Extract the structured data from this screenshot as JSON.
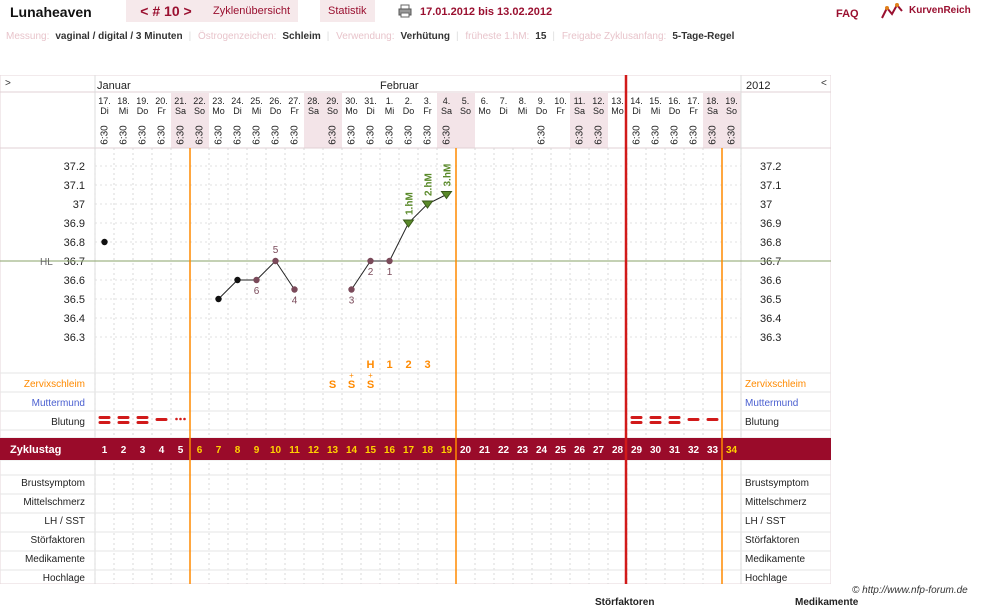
{
  "header": {
    "username": "Lunaheaven",
    "cycle_nav": "< # 10 >",
    "tabs": [
      "Zyklenübersicht",
      "Statistik"
    ],
    "date_range": "17.01.2012 bis 13.02.2012",
    "faq": "FAQ",
    "logo_text": "KurvenReich",
    "icons": [
      "printer-icon",
      "kurvenreich-logo-icon"
    ]
  },
  "settings": [
    {
      "label": "Messung:",
      "value": "vaginal / digital / 3 Minuten"
    },
    {
      "label": "Östrogenzeichen:",
      "value": "Schleim"
    },
    {
      "label": "Verwendung:",
      "value": "Verhütung"
    },
    {
      "label": "früheste 1.hM:",
      "value": "15"
    },
    {
      "label": "Freigabe Zyklusanfang:",
      "value": "5-Tage-Regel"
    }
  ],
  "chart": {
    "nav_left": ">",
    "nav_right": "<",
    "month_labels": [
      "Januar",
      "Februar"
    ],
    "year": "2012",
    "days": [
      {
        "date": "17.",
        "wd": "Di",
        "time": "6:30"
      },
      {
        "date": "18.",
        "wd": "Mi",
        "time": "6:30"
      },
      {
        "date": "19.",
        "wd": "Do",
        "time": "6:30"
      },
      {
        "date": "20.",
        "wd": "Fr",
        "time": "6:30"
      },
      {
        "date": "21.",
        "wd": "Sa",
        "time": "6:30"
      },
      {
        "date": "22.",
        "wd": "So",
        "time": "6:30"
      },
      {
        "date": "23.",
        "wd": "Mo",
        "time": "6:30"
      },
      {
        "date": "24.",
        "wd": "Di",
        "time": "6:30"
      },
      {
        "date": "25.",
        "wd": "Mi",
        "time": "6:30"
      },
      {
        "date": "26.",
        "wd": "Do",
        "time": "6:30"
      },
      {
        "date": "27.",
        "wd": "Fr",
        "time": "6:30"
      },
      {
        "date": "28.",
        "wd": "Sa",
        "time": ""
      },
      {
        "date": "29.",
        "wd": "So",
        "time": "6:30"
      },
      {
        "date": "30.",
        "wd": "Mo",
        "time": "6:30"
      },
      {
        "date": "31.",
        "wd": "Di",
        "time": "6:30"
      },
      {
        "date": "1.",
        "wd": "Mi",
        "time": "6:30"
      },
      {
        "date": "2.",
        "wd": "Do",
        "time": "6:30"
      },
      {
        "date": "3.",
        "wd": "Fr",
        "time": "6:30"
      },
      {
        "date": "4.",
        "wd": "Sa",
        "time": "6:30"
      },
      {
        "date": "5.",
        "wd": "So",
        "time": ""
      },
      {
        "date": "6.",
        "wd": "Mo",
        "time": ""
      },
      {
        "date": "7.",
        "wd": "Di",
        "time": ""
      },
      {
        "date": "8.",
        "wd": "Mi",
        "time": ""
      },
      {
        "date": "9.",
        "wd": "Do",
        "time": "6:30"
      },
      {
        "date": "10.",
        "wd": "Fr",
        "time": ""
      },
      {
        "date": "11.",
        "wd": "Sa",
        "time": "6:30"
      },
      {
        "date": "12.",
        "wd": "So",
        "time": "6:30"
      },
      {
        "date": "13.",
        "wd": "Mo",
        "time": ""
      },
      {
        "date": "14.",
        "wd": "Di",
        "time": "6:30"
      },
      {
        "date": "15.",
        "wd": "Mi",
        "time": "6:30"
      },
      {
        "date": "16.",
        "wd": "Do",
        "time": "6:30"
      },
      {
        "date": "17.",
        "wd": "Fr",
        "time": "6:30"
      },
      {
        "date": "18.",
        "wd": "Sa",
        "time": "6:30"
      },
      {
        "date": "19.",
        "wd": "So",
        "time": "6:30"
      }
    ],
    "temp_ticks": [
      "37.2",
      "37.1",
      "37",
      "36.9",
      "36.8",
      "36.7",
      "36.6",
      "36.5",
      "36.4",
      "36.3"
    ],
    "hl_label": "HL",
    "temps": [
      {
        "day": 1,
        "t": 36.8
      },
      {
        "day": 7,
        "t": 36.5
      },
      {
        "day": 8,
        "t": 36.6
      },
      {
        "day": 9,
        "t": 36.6,
        "label": "6"
      },
      {
        "day": 10,
        "t": 36.7,
        "label": "5"
      },
      {
        "day": 11,
        "t": 36.55,
        "label": "4"
      },
      {
        "day": 14,
        "t": 36.55,
        "label": "3"
      },
      {
        "day": 15,
        "t": 36.7,
        "label": "2"
      },
      {
        "day": 16,
        "t": 36.7,
        "label": "1"
      },
      {
        "day": 17,
        "t": 36.9,
        "hm": "1.hM"
      },
      {
        "day": 18,
        "t": 37.0,
        "hm": "2.hM"
      },
      {
        "day": 19,
        "t": 37.05,
        "hm": "3.hM"
      }
    ],
    "hl_value": 36.7,
    "mucus_top": [
      {
        "day": 15,
        "text": "H"
      },
      {
        "day": 16,
        "text": "1"
      },
      {
        "day": 17,
        "text": "2"
      },
      {
        "day": 18,
        "text": "3"
      }
    ],
    "mucus_symbols": [
      {
        "day": 13,
        "text": "S"
      },
      {
        "day": 14,
        "text": "S"
      },
      {
        "day": 15,
        "text": "S"
      }
    ],
    "row_labels_top": [
      "Zervixschleim",
      "Muttermund",
      "Blutung"
    ],
    "cycle_label": "Zyklustag",
    "cycle_days": [
      "1",
      "2",
      "3",
      "4",
      "5",
      "6",
      "7",
      "8",
      "9",
      "10",
      "11",
      "12",
      "13",
      "14",
      "15",
      "16",
      "17",
      "18",
      "19",
      "20",
      "21",
      "22",
      "23",
      "24",
      "25",
      "26",
      "27",
      "28",
      "29",
      "30",
      "31",
      "32",
      "33",
      "34"
    ],
    "row_labels_bottom": [
      "Brustsymptom",
      "Mittelschmerz",
      "LH / SST",
      "Störfaktoren",
      "Medikamente",
      "Hochlage"
    ],
    "bleeding": [
      {
        "day": 1,
        "type": "heavy"
      },
      {
        "day": 2,
        "type": "heavy"
      },
      {
        "day": 3,
        "type": "heavy"
      },
      {
        "day": 4,
        "type": "medium"
      },
      {
        "day": 5,
        "type": "spotting"
      },
      {
        "day": 29,
        "type": "heavy"
      },
      {
        "day": 30,
        "type": "heavy"
      },
      {
        "day": 31,
        "type": "heavy"
      },
      {
        "day": 32,
        "type": "medium"
      },
      {
        "day": 33,
        "type": "medium"
      }
    ],
    "colors": {
      "accent": "#9a0b2a",
      "orange": "#ff8a00",
      "red_line": "#d11a1a",
      "hl_line": "#8aa36a",
      "hm_green": "#5a8a2a",
      "label_purple": "#7a4a5a",
      "muttermund_blue": "#4a5fd0",
      "weekend_bg": "#f3e4e8"
    }
  },
  "footer": {
    "copyright": "© http://www.nfp-forum.de",
    "cut_left": "Störfaktoren",
    "cut_right": "Medikamente"
  }
}
